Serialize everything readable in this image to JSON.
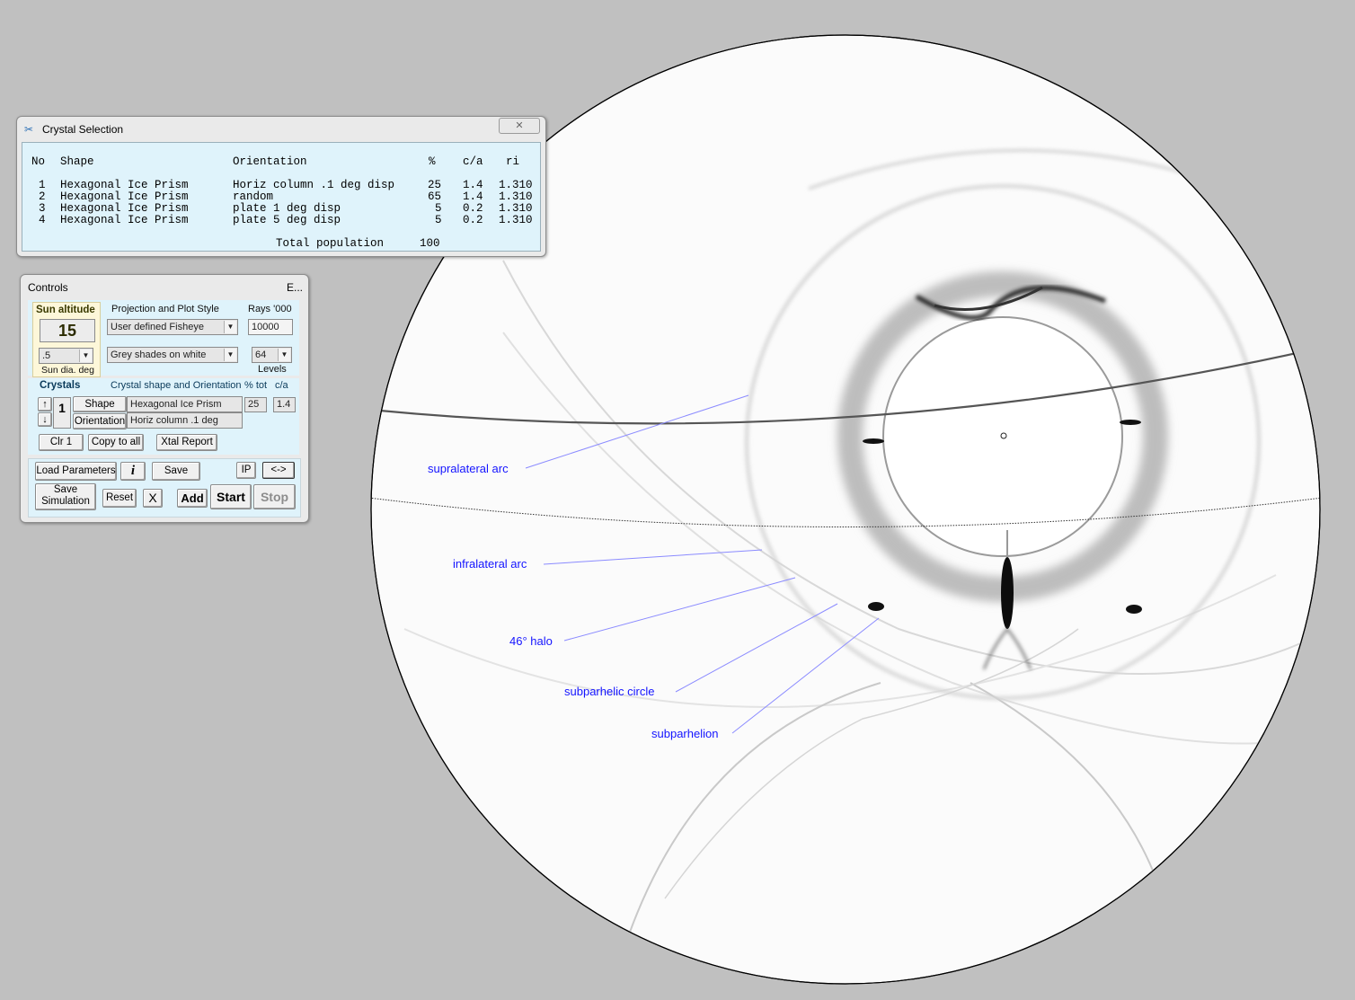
{
  "crystal_window": {
    "title": "Crystal Selection",
    "close_glyph": "✕",
    "headers": {
      "no": "No",
      "shape": "Shape",
      "orientation": "Orientation",
      "pct": "%",
      "ca": "c/a",
      "ri": "ri"
    },
    "rows": [
      {
        "no": "1",
        "shape": "Hexagonal Ice Prism",
        "orientation": "Horiz column .1 deg disp",
        "pct": "25",
        "ca": "1.4",
        "ri": "1.310"
      },
      {
        "no": "2",
        "shape": "Hexagonal Ice Prism",
        "orientation": "random",
        "pct": "65",
        "ca": "1.4",
        "ri": "1.310"
      },
      {
        "no": "3",
        "shape": "Hexagonal Ice Prism",
        "orientation": "plate 1 deg disp",
        "pct": "5",
        "ca": "0.2",
        "ri": "1.310"
      },
      {
        "no": "4",
        "shape": "Hexagonal Ice Prism",
        "orientation": "plate 5 deg disp",
        "pct": "5",
        "ca": "0.2",
        "ri": "1.310"
      }
    ],
    "total_label": "Total population",
    "total_value": "100"
  },
  "controls": {
    "title": "Controls",
    "title_right": "E...",
    "sun_altitude_label": "Sun altitude",
    "sun_altitude": "15",
    "sun_dia_value": ".5",
    "sun_dia_label": "Sun dia. deg",
    "projection_label": "Projection and Plot Style",
    "projection_value": "User defined Fisheye",
    "plot_style_value": "Grey shades on white",
    "rays_label": "Rays '000",
    "rays_value": "10000",
    "levels_value": "64",
    "levels_label": "Levels",
    "crystals_label": "Crystals",
    "shape_orient_label": "Crystal shape and Orientation",
    "pct_tot_label": "% tot",
    "ca_label": "c/a",
    "crystal_index": "1",
    "up_arrow": "↑",
    "down_arrow": "↓",
    "shape_btn": "Shape",
    "orientation_btn": "Orientation",
    "shape_value": "Hexagonal Ice Prism",
    "orientation_value": "Horiz column .1 deg",
    "pct_value": "25",
    "ca_value": "1.4",
    "clr1": "Clr 1",
    "copy_to_all": "Copy to all",
    "xtal_report": "Xtal Report",
    "load_parameters": "Load Parameters",
    "info": "i",
    "save": "Save",
    "ip": "IP",
    "swap": "<->",
    "save_simulation": "Save Simulation",
    "reset": "Reset",
    "x": "X",
    "add": "Add",
    "start": "Start",
    "stop": "Stop"
  },
  "annotations": [
    "supralateral arc",
    "infralateral arc",
    "46° halo",
    "subparhelic circle",
    "subparhelion"
  ],
  "colors": {
    "annotation": "#1414ff",
    "background": "#c0c0c0",
    "panel_blue": "#dff3fb",
    "sun_panel": "#fdf7d9"
  }
}
